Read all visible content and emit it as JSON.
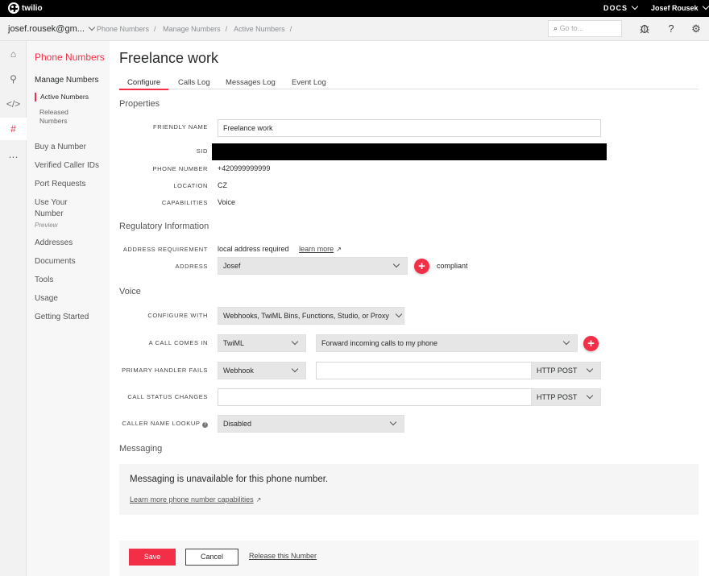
{
  "topbar": {
    "brand": "twilio",
    "docs": "DOCS",
    "user": "Josef Rousek"
  },
  "subbar": {
    "account": "josef.rousek@gm...",
    "breadcrumbs": [
      "Phone Numbers",
      "Manage Numbers",
      "Active Numbers"
    ],
    "search_placeholder": "Go to..."
  },
  "rail": [
    "home-icon",
    "link-icon",
    "code-icon",
    "hash-icon",
    "more-icon"
  ],
  "sidenav": {
    "title": "Phone Numbers",
    "manage": "Manage Numbers",
    "active_numbers": "Active Numbers",
    "released_numbers_1": "Released",
    "released_numbers_2": "Numbers",
    "buy": "Buy a Number",
    "verified": "Verified Caller IDs",
    "port": "Port Requests",
    "use_your_1": "Use Your",
    "use_your_2": "Number",
    "preview": "Preview",
    "addresses": "Addresses",
    "documents": "Documents",
    "tools": "Tools",
    "usage": "Usage",
    "getting_started": "Getting Started"
  },
  "page": {
    "title": "Freelance work",
    "tabs": [
      "Configure",
      "Calls Log",
      "Messages Log",
      "Event Log"
    ]
  },
  "properties": {
    "heading": "Properties",
    "friendly_name_label": "FRIENDLY NAME",
    "friendly_name": "Freelance work",
    "sid_label": "SID",
    "phone_label": "PHONE NUMBER",
    "phone": "+420999999999",
    "location_label": "LOCATION",
    "location": "CZ",
    "capabilities_label": "CAPABILITIES",
    "capabilities": "Voice"
  },
  "regulatory": {
    "heading": "Regulatory Information",
    "addr_req_label": "ADDRESS REQUIREMENT",
    "addr_req": "local address required",
    "learn_more": "learn more",
    "address_label": "ADDRESS",
    "address": "Josef",
    "compliant": "compliant"
  },
  "voice": {
    "heading": "Voice",
    "configure_with_label": "CONFIGURE WITH",
    "configure_with": "Webhooks, TwiML Bins, Functions, Studio, or Proxy",
    "call_comes_in_label": "A CALL COMES IN",
    "call_comes_in_type": "TwiML",
    "call_comes_in_value": "Forward incoming calls to my phone",
    "primary_fails_label": "PRIMARY HANDLER FAILS",
    "primary_fails_type": "Webhook",
    "primary_fails_url": "",
    "primary_fails_method": "HTTP POST",
    "status_changes_label": "CALL STATUS CHANGES",
    "status_changes_url": "",
    "status_changes_method": "HTTP POST",
    "caller_name_label": "CALLER NAME LOOKUP",
    "caller_name": "Disabled"
  },
  "messaging": {
    "heading": "Messaging",
    "unavailable": "Messaging is unavailable for this phone number.",
    "learn_more": "Learn more phone number capabilities"
  },
  "footer": {
    "save": "Save",
    "cancel": "Cancel",
    "release": "Release this Number"
  },
  "colors": {
    "accent": "#f22f46",
    "topbar": "#000000"
  }
}
